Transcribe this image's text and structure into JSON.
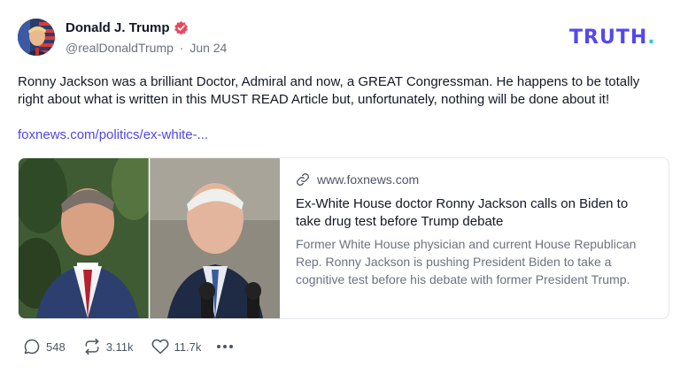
{
  "author": {
    "name": "Donald J. Trump",
    "handle": "@realDonaldTrump",
    "separator": "·",
    "date": "Jun 24",
    "verified_color": "#e8475f"
  },
  "brand": {
    "text": "TRUTH",
    "suffix": ".",
    "color": "#5448ee",
    "accent": "#22d3c5"
  },
  "post": {
    "text": "Ronny Jackson was a brilliant Doctor, Admiral and now, a GREAT Congressman. He happens to be totally right about what is written in this MUST READ Article but, unfortunately, nothing will be done about it!",
    "link": "foxnews.com/politics/ex-white-..."
  },
  "card": {
    "domain": "www.foxnews.com",
    "title": "Ex-White House doctor Ronny Jackson calls on Biden to take drug test before Trump debate",
    "description": "Former White House physician and current House Republican Rep. Ronny Jackson is pushing President Biden to take a cognitive test before his debate with former President Trump."
  },
  "actions": {
    "replies": "548",
    "retruths": "3.11k",
    "likes": "11.7k"
  }
}
